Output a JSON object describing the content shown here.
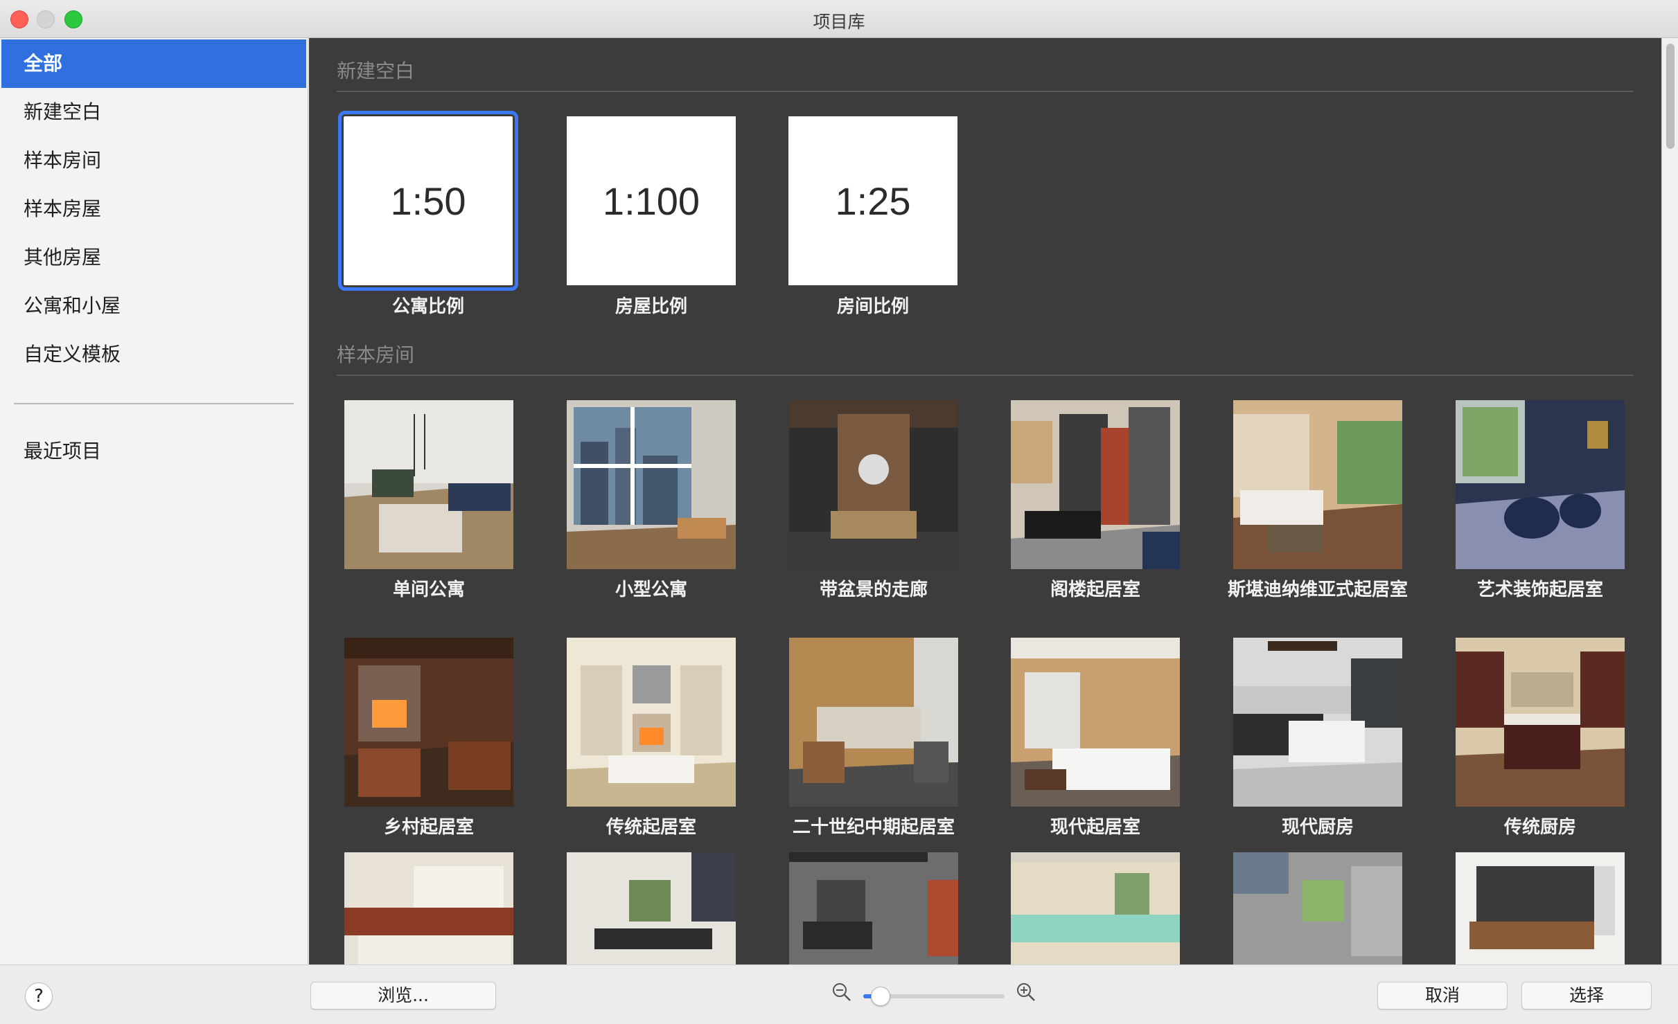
{
  "window": {
    "title": "项目库"
  },
  "sidebar": {
    "items": [
      {
        "label": "全部",
        "active": true
      },
      {
        "label": "新建空白"
      },
      {
        "label": "样本房间"
      },
      {
        "label": "样本房屋"
      },
      {
        "label": "其他房屋"
      },
      {
        "label": "公寓和小屋"
      },
      {
        "label": "自定义模板"
      }
    ],
    "recent": {
      "label": "最近项目"
    }
  },
  "sections": {
    "blank": {
      "title": "新建空白",
      "items": [
        {
          "scale": "1:50",
          "label": "公寓比例",
          "selected": true
        },
        {
          "scale": "1:100",
          "label": "房屋比例"
        },
        {
          "scale": "1:25",
          "label": "房间比例"
        }
      ]
    },
    "sample_rooms": {
      "title": "样本房间",
      "items": [
        {
          "label": "单间公寓"
        },
        {
          "label": "小型公寓"
        },
        {
          "label": "带盆景的走廊"
        },
        {
          "label": "阁楼起居室"
        },
        {
          "label": "斯堪迪纳维亚式起居室"
        },
        {
          "label": "艺术装饰起居室"
        },
        {
          "label": "乡村起居室"
        },
        {
          "label": "传统起居室"
        },
        {
          "label": "二十世纪中期起居室"
        },
        {
          "label": "现代起居室"
        },
        {
          "label": "现代厨房"
        },
        {
          "label": "传统厨房"
        }
      ]
    }
  },
  "bottom_bar": {
    "help_label": "?",
    "browse_label": "浏览...",
    "cancel_label": "取消",
    "select_label": "选择",
    "zoom_level": 0.08
  },
  "colors": {
    "accent": "#2f6fde",
    "content_bg": "#3c3c3c"
  }
}
